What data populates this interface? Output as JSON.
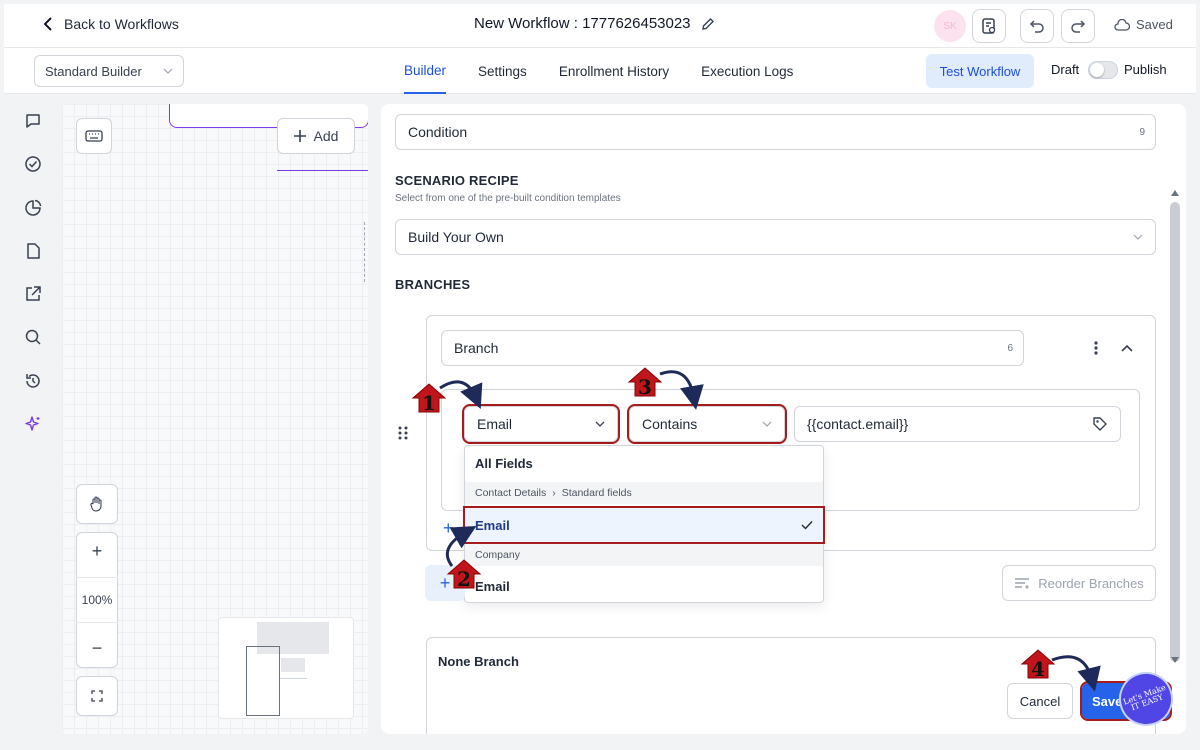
{
  "header": {
    "back_label": "Back to Workflows",
    "workflow_title": "New Workflow : 1777626453023",
    "avatar_initials": "SK",
    "saved_label": "Saved"
  },
  "subbar": {
    "builder_select": "Standard Builder",
    "tabs": [
      {
        "label": "Builder",
        "active": true
      },
      {
        "label": "Settings"
      },
      {
        "label": "Enrollment History"
      },
      {
        "label": "Execution Logs"
      }
    ],
    "test_workflow_label": "Test Workflow",
    "draft_label": "Draft",
    "publish_label": "Publish"
  },
  "canvas": {
    "add_label": "Add",
    "zoom_in": "+",
    "zoom_level": "100%",
    "zoom_out": "−"
  },
  "panel": {
    "condition_name": "Condition",
    "condition_name_count": "9",
    "scenario_title": "SCENARIO RECIPE",
    "scenario_subtitle": "Select from one of the pre-built condition templates",
    "scenario_value": "Build Your Own",
    "branches_title": "BRANCHES",
    "branch_name": "Branch",
    "branch_name_count": "6",
    "field_select": "Email",
    "operator_select": "Contains",
    "value_input": "{{contact.email}}",
    "dropdown": {
      "header": "All Fields",
      "breadcrumb_1": "Contact Details",
      "breadcrumb_2": "Standard fields",
      "selected_item": "Email",
      "group_label": "Company",
      "item_2": "Email"
    },
    "reorder_label": "Reorder Branches",
    "none_branch_label": "None Branch",
    "cancel_label": "Cancel",
    "save_label": "Save"
  },
  "annotations": {
    "step_1": "1",
    "step_2": "2",
    "step_3": "3",
    "step_4": "4",
    "watermark": "Let's Make IT EASY"
  },
  "colors": {
    "accent": "#2563eb",
    "annotation_red": "#c0161b",
    "annotation_box": "#a61b1b",
    "connector_purple": "#7c3aed"
  }
}
